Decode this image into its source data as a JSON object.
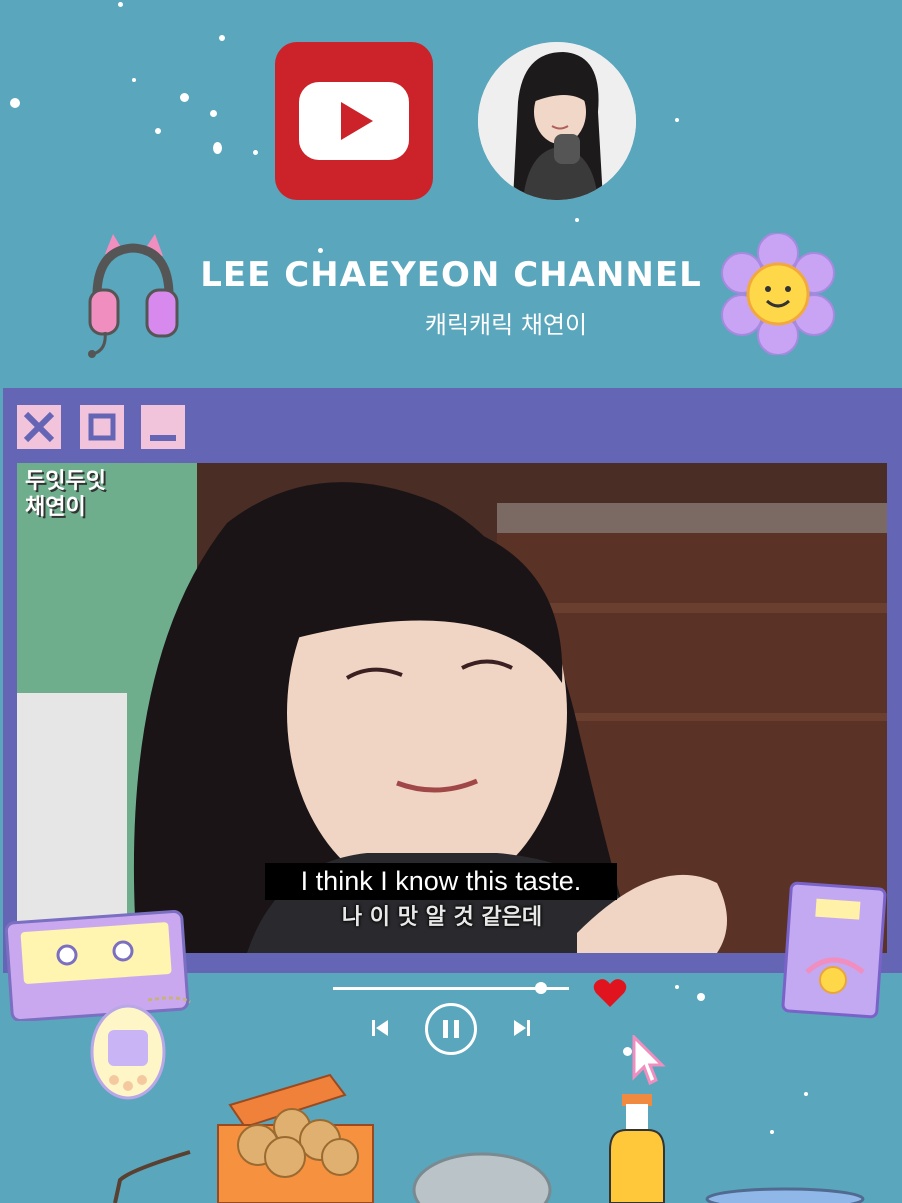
{
  "header": {
    "channel_title": "LEE CHAEYEON CHANNEL",
    "channel_subtitle": "캐릭캐릭 채연이"
  },
  "window_controls": {
    "icons": [
      "close-icon",
      "maximize-icon",
      "minimize-icon"
    ]
  },
  "video": {
    "watermark_line1": "두잇두잇",
    "watermark_line2": "채연이",
    "subtitle_en": "I think I know this taste.",
    "subtitle_ko": "나 이 맛 알 것 같은데"
  },
  "player": {
    "progress": 0.88,
    "liked": true,
    "state": "playing"
  },
  "colors": {
    "background": "#5aa6bd",
    "window": "#6565b5",
    "window_buttons": "#f2c4dc",
    "youtube_red": "#cc2229",
    "heart": "#e0141e"
  }
}
